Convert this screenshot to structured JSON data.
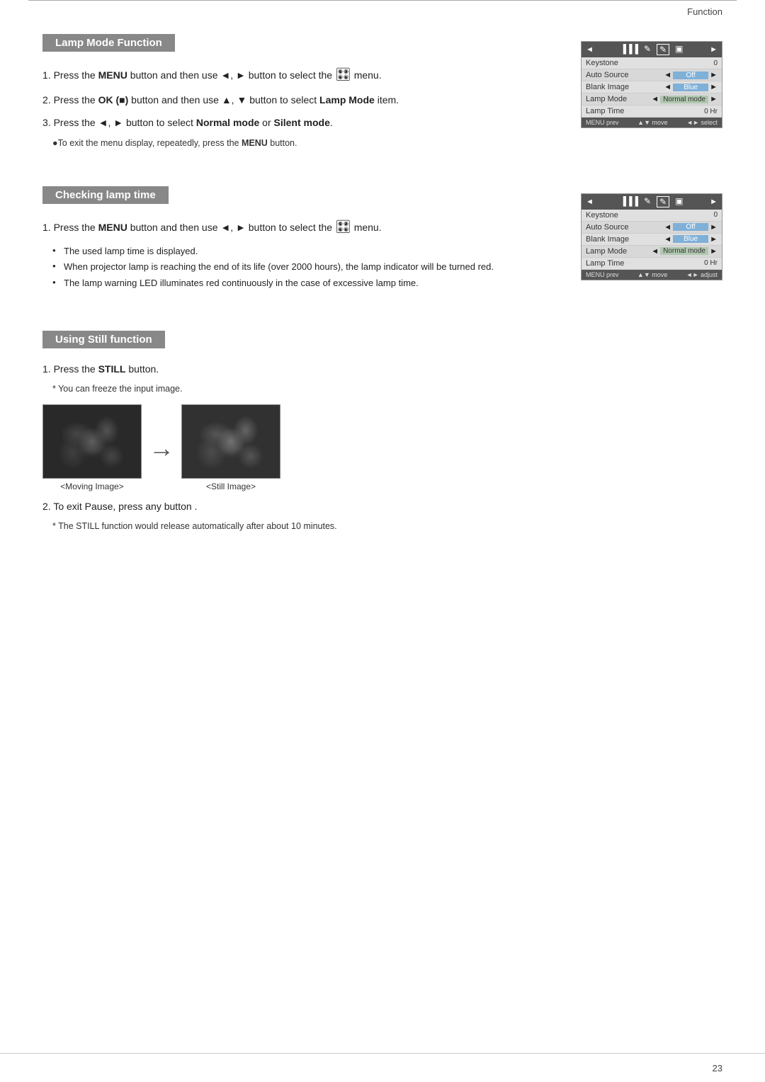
{
  "header": {
    "title": "Function"
  },
  "footer": {
    "page_number": "23"
  },
  "sections": [
    {
      "id": "lamp-mode",
      "header": "Lamp Mode Function",
      "steps": [
        {
          "number": "1",
          "text_parts": [
            "Press the ",
            "MENU",
            " button and then use ◄, ► button to select the ",
            "menu."
          ]
        },
        {
          "number": "2",
          "text_parts": [
            "Press the ",
            "OK (■)",
            " button and then use ▲, ▼ button to select ",
            "Lamp Mode",
            " item."
          ]
        },
        {
          "number": "3",
          "text_parts": [
            "Press the ◄, ► button to select ",
            "Normal mode",
            " or ",
            "Silent mode",
            "."
          ]
        }
      ],
      "note": "●To exit the menu display, repeatedly, press the MENU button.",
      "menu": {
        "header_icons": [
          "▐▐▐",
          "✎",
          "✎",
          "▣"
        ],
        "active_index": 3,
        "rows": [
          {
            "label": "Keystone",
            "value": "0",
            "type": "plain"
          },
          {
            "label": "Auto Source",
            "value": "Off",
            "type": "blue"
          },
          {
            "label": "Blank Image",
            "value": "Blue",
            "type": "blue"
          },
          {
            "label": "Lamp Mode",
            "value": "Normal mode",
            "type": "normal"
          },
          {
            "label": "Lamp Time",
            "value": "0 Hr",
            "type": "plain"
          }
        ],
        "footer_left": "MENU prev",
        "footer_mid": "▲▼ move",
        "footer_right": "◄► select"
      }
    },
    {
      "id": "checking-lamp",
      "header": "Checking lamp time",
      "steps": [
        {
          "number": "1",
          "text_parts": [
            "Press the ",
            "MENU",
            " button and then use ◄, ► button to select the ",
            "menu."
          ]
        }
      ],
      "bullets": [
        "The used lamp time is displayed.",
        "When projector lamp is reaching the end of its life (over 2000 hours), the lamp indicator will be turned red.",
        "The lamp warning LED illuminates red continuously in the case of excessive lamp time."
      ],
      "menu": {
        "rows": [
          {
            "label": "Keystone",
            "value": "0",
            "type": "plain"
          },
          {
            "label": "Auto Source",
            "value": "Off",
            "type": "blue"
          },
          {
            "label": "Blank Image",
            "value": "Blue",
            "type": "blue"
          },
          {
            "label": "Lamp Mode",
            "value": "Normal mode",
            "type": "normal"
          },
          {
            "label": "Lamp Time",
            "value": "0 Hr",
            "type": "plain"
          }
        ],
        "footer_left": "MENU prev",
        "footer_mid": "▲▼ move",
        "footer_right": "◄► adjust"
      }
    },
    {
      "id": "still-function",
      "header": "Using Still function",
      "steps": [
        {
          "number": "1",
          "text_parts": [
            "Press the ",
            "STILL",
            " button."
          ]
        }
      ],
      "note1": "* You can freeze the input image.",
      "image_caption_left": "<Moving Image>",
      "image_caption_right": "<Still Image>",
      "step2_text": "To exit Pause, press any button .",
      "note2": "* The STILL function would release automatically after about 10 minutes."
    }
  ]
}
